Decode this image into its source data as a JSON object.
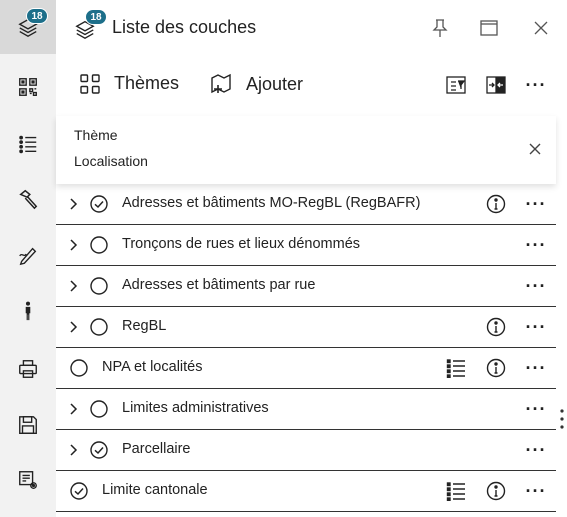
{
  "rail": {
    "badge_count": "18",
    "items": [
      {
        "icon": "layers-icon"
      },
      {
        "icon": "qr-grid-icon"
      },
      {
        "icon": "list-icon"
      },
      {
        "icon": "hammer-icon"
      },
      {
        "icon": "pencil-ruler-icon"
      },
      {
        "icon": "person-icon"
      },
      {
        "icon": "printer-icon"
      },
      {
        "icon": "save-icon"
      },
      {
        "icon": "settings-list-icon"
      }
    ]
  },
  "header": {
    "badge_count": "18",
    "title": "Liste des couches"
  },
  "toolbar": {
    "themes_label": "Thèmes",
    "add_label": "Ajouter"
  },
  "filter": {
    "line1": "Thème",
    "line2": "Localisation"
  },
  "layers": [
    {
      "name": "Adresses et bâtiments MO-RegBL (RegBAFR)",
      "expandable": true,
      "checked": true,
      "legend": false,
      "info": true
    },
    {
      "name": "Tronçons de rues et lieux dénommés",
      "expandable": true,
      "checked": false,
      "legend": false,
      "info": false
    },
    {
      "name": "Adresses et bâtiments par rue",
      "expandable": true,
      "checked": false,
      "legend": false,
      "info": false
    },
    {
      "name": "RegBL",
      "expandable": true,
      "checked": false,
      "legend": false,
      "info": true
    },
    {
      "name": "NPA et localités",
      "expandable": false,
      "checked": false,
      "legend": true,
      "info": true
    },
    {
      "name": "Limites administratives",
      "expandable": true,
      "checked": false,
      "legend": false,
      "info": false
    },
    {
      "name": "Parcellaire",
      "expandable": true,
      "checked": true,
      "legend": false,
      "info": false
    },
    {
      "name": "Limite cantonale",
      "expandable": false,
      "checked": true,
      "legend": true,
      "info": true
    }
  ],
  "colors": {
    "badge": "#1d6f8a",
    "rail_bg": "#f2f2f2",
    "rail_active": "#d9d9d9"
  }
}
